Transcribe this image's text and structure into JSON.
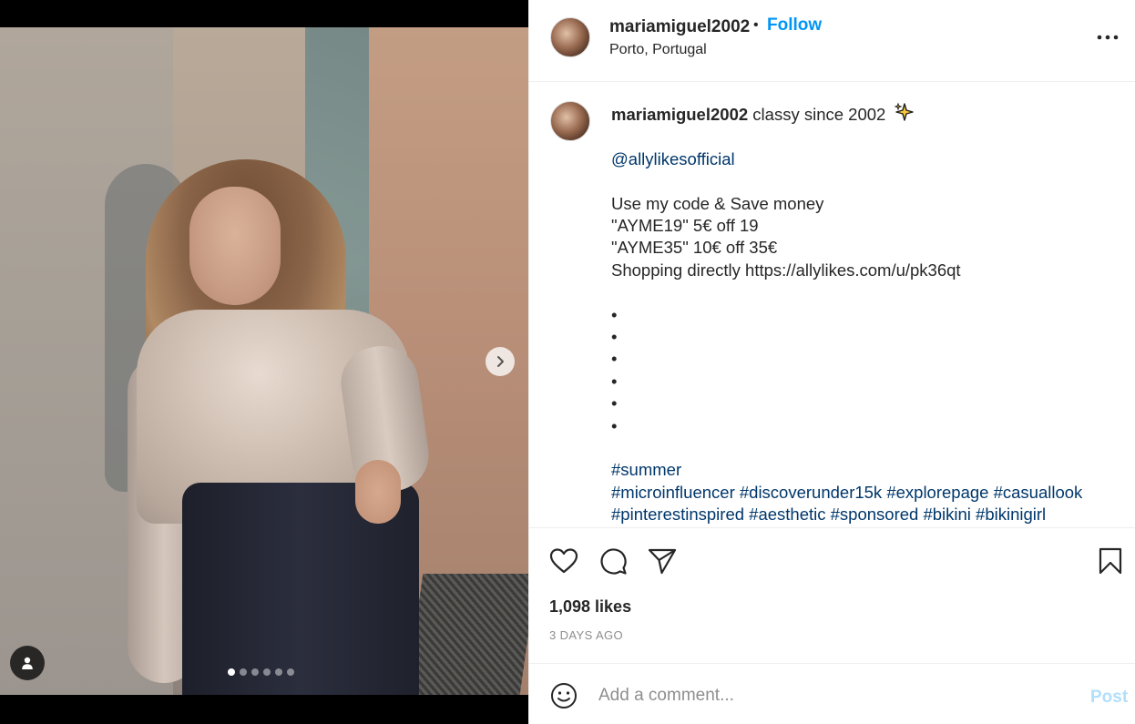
{
  "header": {
    "username": "mariamiguel2002",
    "separator": "•",
    "follow_label": "Follow",
    "location": "Porto, Portugal"
  },
  "caption": {
    "username": "mariamiguel2002",
    "intro": "classy since 2002",
    "mention": "@allylikesofficial",
    "promo_lines": [
      "Use my code & Save money",
      "\"AYME19\" 5€ off 19",
      "\"AYME35\" 10€ off 35€",
      "Shopping directly https://allylikes.com/u/pk36qt"
    ],
    "bullets": [
      "•",
      "•",
      "•",
      "•",
      "•",
      "•"
    ],
    "hashtag_lines": [
      "#summer",
      "#microinfluencer #discoverunder15k #explorepage #casuallook",
      "#pinterestinspired #aesthetic #sponsored #bikini #bikinigirl"
    ]
  },
  "stats": {
    "likes": "1,098 likes",
    "posted": "3 DAYS AGO"
  },
  "comment": {
    "placeholder": "Add a comment...",
    "post_label": "Post"
  },
  "carousel": {
    "current_index": 1,
    "total": 6
  },
  "colors": {
    "accent": "#0095f6",
    "link": "#00376b",
    "post_disabled": "#b2dffc",
    "muted": "#8e8e8e",
    "text": "#262626"
  },
  "icons": [
    "chevron-right-icon",
    "user-tag-icon",
    "more-icon",
    "heart-icon",
    "comment-icon",
    "share-icon",
    "bookmark-icon",
    "smile-icon",
    "sparkles-icon"
  ]
}
